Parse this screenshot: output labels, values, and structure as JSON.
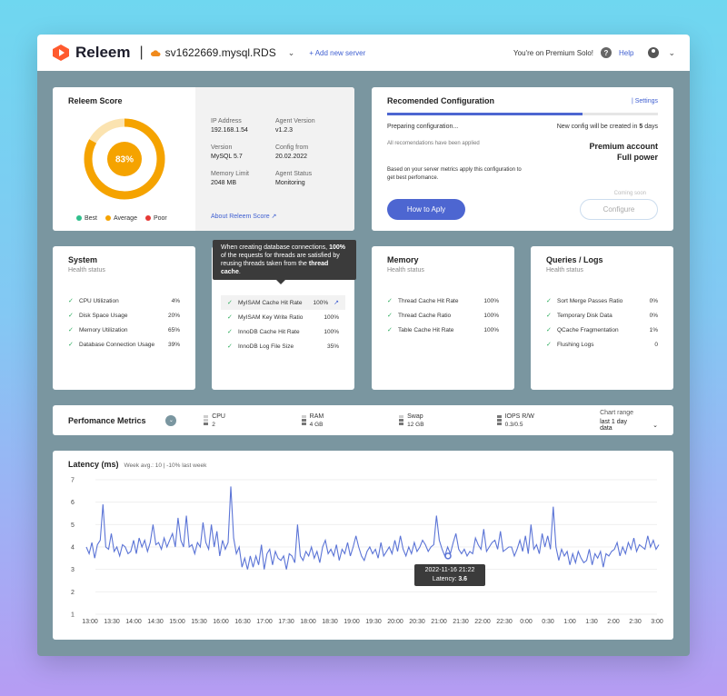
{
  "app": {
    "brand": "Releem",
    "separator": "|",
    "server": "sv1622669.mysql.RDS",
    "add_server": "+ Add new server",
    "plan_text": "You're on Premium Solo!",
    "help": "Help"
  },
  "colors": {
    "accent": "#4d66d1",
    "score": "#f5a300",
    "best": "#2fbf8c",
    "average": "#f5a300",
    "poor": "#e53935",
    "check": "#2fae5e"
  },
  "score": {
    "title": "Releem Score",
    "value_text": "83%",
    "value": 0.83,
    "legend": [
      "Best",
      "Average",
      "Poor"
    ],
    "info": [
      {
        "k": "IP Address",
        "v": "192.168.1.54"
      },
      {
        "k": "Agent Version",
        "v": "v1.2.3"
      },
      {
        "k": "Version",
        "v": "MySQL 5.7"
      },
      {
        "k": "Config from",
        "v": "20.02.2022"
      },
      {
        "k": "Memory Limit",
        "v": "2048 MB"
      },
      {
        "k": "Agent Status",
        "v": "Monitoring"
      }
    ],
    "about": "About Releem Score"
  },
  "recommended": {
    "title": "Recomended Configuration",
    "settings": "| Settings",
    "progress": 0.72,
    "preparing": "Preparing configuration...",
    "created_prefix": "New config will be created in ",
    "created_days": "5",
    "created_suffix": " days",
    "all_applied": "All recomendations have been  applied",
    "premium1": "Premium account",
    "premium2": "Full power",
    "based_on": "Based on your server metrics apply this configuration to get best perfomance.",
    "how_button": "How to Aply",
    "coming_soon": "Coming soon",
    "configure_button": "Configure"
  },
  "system": {
    "title": "System",
    "sub": "Health status",
    "rows": [
      {
        "label": "CPU Utilization",
        "value": "4%"
      },
      {
        "label": "Disk Space Usage",
        "value": "20%"
      },
      {
        "label": "Memory Utilization",
        "value": "65%"
      },
      {
        "label": "Database Connection Usage",
        "value": "39%"
      }
    ]
  },
  "engine": {
    "rows": [
      {
        "label": "MyISAM Cache Hit Rate",
        "value": "100%"
      },
      {
        "label": "MyISAM Key Write Ratio",
        "value": "100%"
      },
      {
        "label": "InnoDB Cache Hit Rate",
        "value": "100%"
      },
      {
        "label": "InnoDB Log File Size",
        "value": "35%"
      }
    ],
    "tooltip": {
      "p1": "When creating database connections, ",
      "bold1": "100%",
      "p2": " of the requests for threads are satisfied by reusing threads taken from the ",
      "bold2": "thread cache",
      "p3": "."
    }
  },
  "memory": {
    "title": "Memory",
    "sub": "Health status",
    "rows": [
      {
        "label": "Thread Cache Hit Rate",
        "value": "100%"
      },
      {
        "label": "Thread Cache Ratio",
        "value": "100%"
      },
      {
        "label": "Table Cache Hit Rate",
        "value": "100%"
      }
    ]
  },
  "queries": {
    "title": "Queries / Logs",
    "sub": "Health status",
    "rows": [
      {
        "label": "Sort Merge Passes Ratio",
        "value": "0%"
      },
      {
        "label": "Temporary Disk Data",
        "value": "0%"
      },
      {
        "label": "QCache Fragmentation",
        "value": "1%"
      },
      {
        "label": "Flushing Logs",
        "value": "0"
      }
    ]
  },
  "metrics": {
    "title": "Perfomance Metrics",
    "items": [
      {
        "label": "CPU",
        "value": "2"
      },
      {
        "label": "RAM",
        "value": "4 GB"
      },
      {
        "label": "Swap",
        "value": "12 GB"
      },
      {
        "label": "IOPS R/W",
        "value": "0.3/0.5"
      }
    ],
    "range_label": "Chart range",
    "range_value": "last 1 day data"
  },
  "latency": {
    "title": "Latency (ms)",
    "sub": "Week avg.: 10  | -10% last week",
    "tooltip_time": "2022-11-16 21:22",
    "tooltip_label": "Latency: ",
    "tooltip_value": "3.6"
  },
  "chart_data": {
    "type": "line",
    "title": "Latency (ms)",
    "ylim": [
      1,
      7
    ],
    "yticks": [
      1,
      2,
      3,
      4,
      5,
      6,
      7
    ],
    "xticks": [
      "13:00",
      "13:30",
      "14:00",
      "14:30",
      "15:00",
      "15:30",
      "16:00",
      "16:30",
      "17:00",
      "17:30",
      "18:00",
      "18:30",
      "19:00",
      "19:30",
      "20:00",
      "20:30",
      "21:00",
      "21:30",
      "22:00",
      "22:30",
      "0:00",
      "0:30",
      "1:00",
      "1:30",
      "2:00",
      "2:30",
      "3:00"
    ],
    "series": [
      {
        "values": [
          4.0,
          3.7,
          4.2,
          3.5,
          4.1,
          4.3,
          5.9,
          4.0,
          3.9,
          4.6,
          3.8,
          4.0,
          3.6,
          4.1,
          4.0,
          3.7,
          3.8,
          4.3,
          3.7,
          4.4,
          4.0,
          4.3,
          3.8,
          4.2,
          5.0,
          4.1,
          4.2,
          3.9,
          4.4,
          4.0,
          4.3,
          4.6,
          4.0,
          5.3,
          4.3,
          4.0,
          5.4,
          4.0,
          4.1,
          3.7,
          4.2,
          4.0,
          5.1,
          4.2,
          3.9,
          5.0,
          4.0,
          4.7,
          3.6,
          4.3,
          3.9,
          4.2,
          6.7,
          4.4,
          3.7,
          4.0,
          3.1,
          3.5,
          3.0,
          3.6,
          3.1,
          3.6,
          3.2,
          4.1,
          3.0,
          3.7,
          3.9,
          3.2,
          3.8,
          3.5,
          3.4,
          3.6,
          3.0,
          3.7,
          3.6,
          3.3,
          5.0,
          3.6,
          3.4,
          3.8,
          3.6,
          4.0,
          3.5,
          3.8,
          3.3,
          4.0,
          4.3,
          3.7,
          3.9,
          3.6,
          4.1,
          3.4,
          3.9,
          3.7,
          4.2,
          3.6,
          4.0,
          4.5,
          4.0,
          3.6,
          3.4,
          3.8,
          4.0,
          3.7,
          3.9,
          3.5,
          4.2,
          3.6,
          3.8,
          4.0,
          3.7,
          4.3,
          3.8,
          4.5,
          3.9,
          3.6,
          4.0,
          3.7,
          4.2,
          3.8,
          4.0,
          4.3,
          4.1,
          3.8,
          4.0,
          4.1,
          5.4,
          4.3,
          3.9,
          3.6,
          4.0,
          3.7,
          4.2,
          4.6,
          3.9,
          3.7,
          3.9,
          3.6,
          3.8,
          3.7,
          4.4,
          4.1,
          3.9,
          4.8,
          3.8,
          4.0,
          4.2,
          4.3,
          3.9,
          4.7,
          3.8,
          3.9,
          4.0,
          4.0,
          3.6,
          3.9,
          4.3,
          3.8,
          4.5,
          3.7,
          5.0,
          3.9,
          4.1,
          3.7,
          4.6,
          4.0,
          4.5,
          3.9,
          5.8,
          4.0,
          3.4,
          3.9,
          3.6,
          3.8,
          3.2,
          3.7,
          3.3,
          3.8,
          3.5,
          3.3,
          3.4,
          3.9,
          3.2,
          3.7,
          3.5,
          3.8,
          3.1,
          3.7,
          3.6,
          3.8,
          3.9,
          4.2,
          3.6,
          4.0,
          3.7,
          4.2,
          3.9,
          4.4,
          3.8,
          4.1,
          4.0,
          3.9,
          4.5,
          4.0,
          4.3,
          3.9,
          4.1
        ]
      }
    ]
  }
}
